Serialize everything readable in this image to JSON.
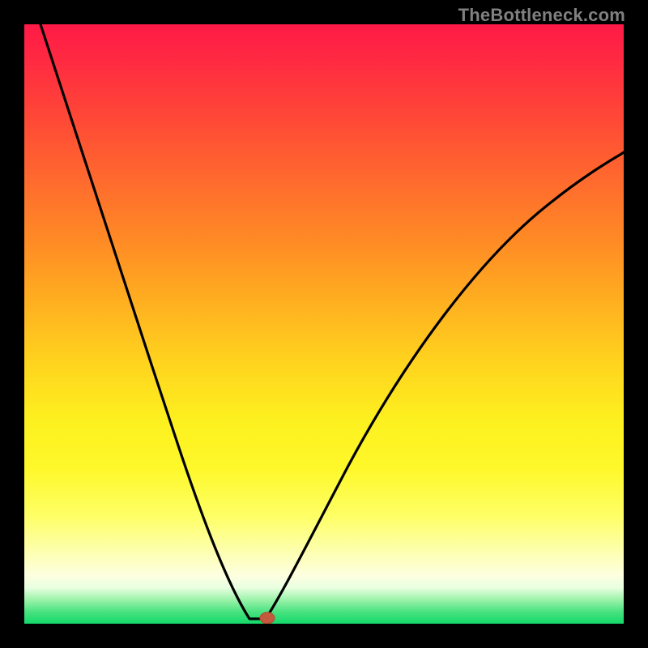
{
  "attribution": "TheBottleneck.com",
  "chart_data": {
    "type": "line",
    "title": "",
    "xlabel": "",
    "ylabel": "",
    "xlim": [
      0,
      100
    ],
    "ylim": [
      0,
      100
    ],
    "grid": false,
    "legend": false,
    "background": "rainbow-gradient",
    "series": [
      {
        "name": "bottleneck-curve",
        "x": [
          0,
          5,
          10,
          15,
          20,
          25,
          30,
          33,
          35,
          37,
          38,
          41,
          44,
          48,
          52,
          58,
          66,
          76,
          88,
          100
        ],
        "values": [
          100,
          86,
          72,
          58,
          45,
          33,
          21,
          12,
          6,
          2,
          0,
          0,
          3,
          8,
          16,
          27,
          40,
          54,
          67,
          78
        ]
      }
    ],
    "marker": {
      "x": 40.5,
      "y": 0,
      "color": "#c45a3d"
    },
    "gradient_stops": [
      {
        "pos": 0.0,
        "color": "#ff1a46"
      },
      {
        "pos": 0.5,
        "color": "#ffc01e"
      },
      {
        "pos": 0.8,
        "color": "#fbff50"
      },
      {
        "pos": 1.0,
        "color": "#12d96b"
      }
    ]
  }
}
